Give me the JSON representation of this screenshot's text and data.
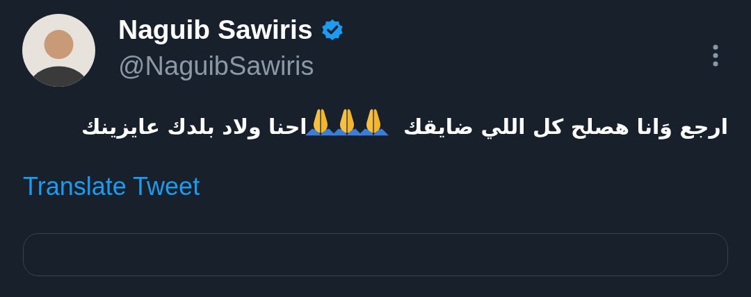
{
  "author": {
    "name": "Naguib Sawiris",
    "verified": true,
    "handle": "@NaguibSawiris"
  },
  "body": [
    {
      "kind": "text",
      "text": "ارجع وَانا هصلح كل اللي ضايقك"
    },
    {
      "kind": "emoji"
    },
    {
      "kind": "emoji"
    },
    {
      "kind": "emoji"
    },
    {
      "kind": "text",
      "text": "احنا ولاد بلدك عايزينك"
    }
  ],
  "translate_link": "Translate Tweet"
}
